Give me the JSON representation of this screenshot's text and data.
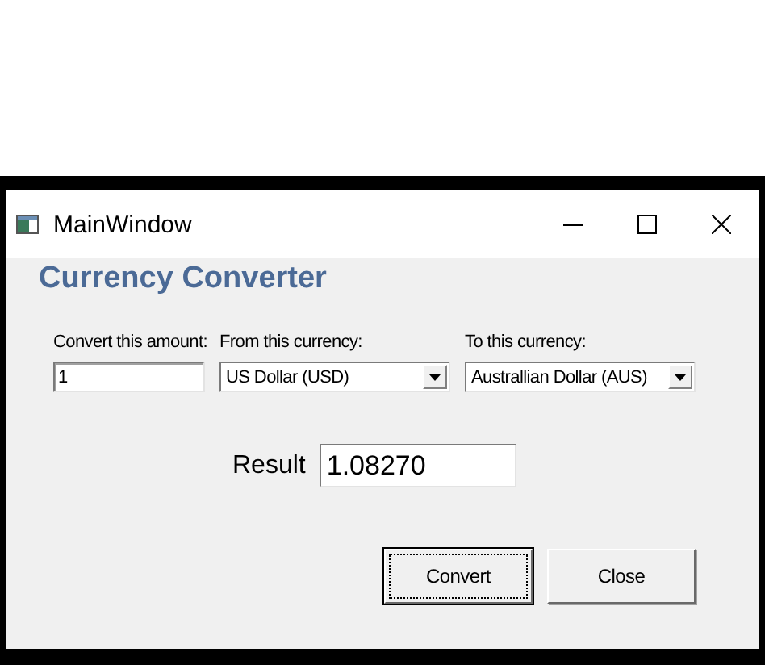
{
  "window": {
    "title": "MainWindow"
  },
  "heading": "Currency Converter",
  "fields": [
    {
      "kind": "text",
      "label": "Convert this amount:",
      "value": "1"
    },
    {
      "kind": "select",
      "label": "From this currency:",
      "value": "US Dollar (USD)"
    },
    {
      "kind": "select",
      "label": "To this currency:",
      "value": "Australlian Dollar (AUS)"
    }
  ],
  "result": {
    "label": "Result",
    "value": "1.08270"
  },
  "buttons": [
    {
      "label": "Convert",
      "focused": true
    },
    {
      "label": "Close",
      "focused": false
    }
  ]
}
